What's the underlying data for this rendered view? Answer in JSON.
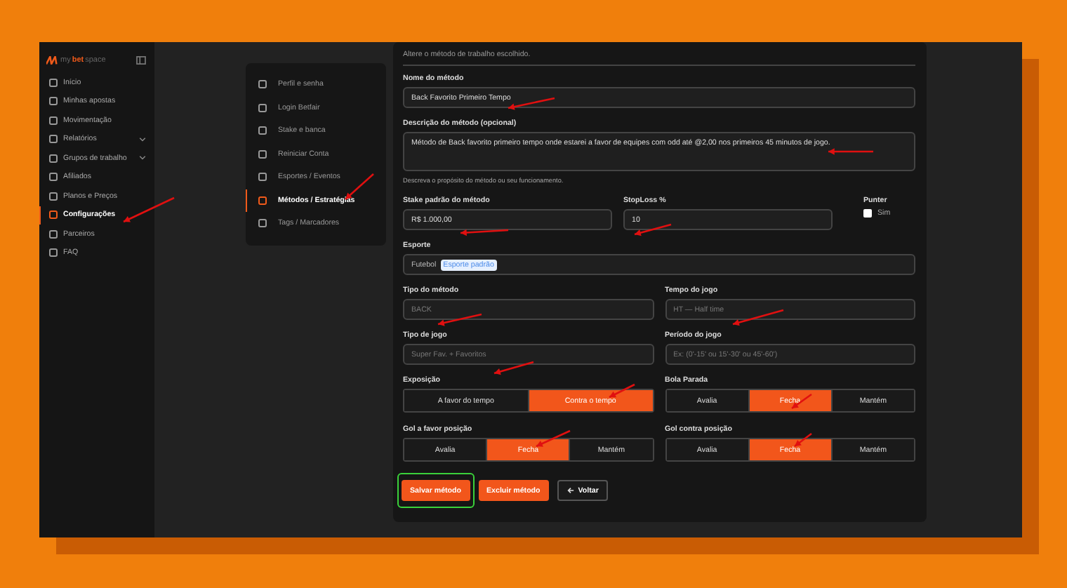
{
  "logo": {
    "prefix": "my",
    "brand": "bet",
    "suffix": "space"
  },
  "sidebar": {
    "items": [
      {
        "label": "Início",
        "selected": false,
        "expandable": false
      },
      {
        "label": "Minhas apostas",
        "selected": false,
        "expandable": false
      },
      {
        "label": "Movimentação",
        "selected": false,
        "expandable": false
      },
      {
        "label": "Relatórios",
        "selected": false,
        "expandable": true
      },
      {
        "label": "Grupos de trabalho",
        "selected": false,
        "expandable": true
      },
      {
        "label": "Afiliados",
        "selected": false,
        "expandable": false
      },
      {
        "label": "Planos e Preços",
        "selected": false,
        "expandable": false
      },
      {
        "label": "Configurações",
        "selected": true,
        "expandable": false
      },
      {
        "label": "Parceiros",
        "selected": false,
        "expandable": false
      },
      {
        "label": "FAQ",
        "selected": false,
        "expandable": false
      }
    ]
  },
  "settings_menu": {
    "items": [
      {
        "label": "Perfil e senha",
        "selected": false
      },
      {
        "label": "Login Betfair",
        "selected": false
      },
      {
        "label": "Stake e banca",
        "selected": false
      },
      {
        "label": "Reiniciar Conta",
        "selected": false
      },
      {
        "label": "Esportes / Eventos",
        "selected": false
      },
      {
        "label": "Métodos / Estratégias",
        "selected": true
      },
      {
        "label": "Tags / Marcadores",
        "selected": false
      }
    ]
  },
  "form": {
    "subtitle": "Altere o método de trabalho escolhido.",
    "name": {
      "label": "Nome do método",
      "value": "Back Favorito Primeiro Tempo"
    },
    "description": {
      "label": "Descrição do método (opcional)",
      "value": "Método de Back favorito primeiro tempo onde estarei a favor de equipes com odd até @2,00 nos primeiros 45 minutos de jogo.",
      "hint": "Descreva o propósito do método ou seu funcionamento."
    },
    "stake": {
      "label": "Stake padrão do método",
      "value": "R$ 1.000,00"
    },
    "stoploss": {
      "label": "StopLoss %",
      "value": "10"
    },
    "punter": {
      "label": "Punter",
      "option": "Sim",
      "checked": false
    },
    "sport": {
      "label": "Esporte",
      "value": "Futebol",
      "tag": "Esporte padrão"
    },
    "selects": [
      {
        "label": "Tipo do método",
        "placeholder": "BACK"
      },
      {
        "label": "Tempo do jogo",
        "placeholder": "HT — Half time"
      },
      {
        "label": "Tipo de jogo",
        "placeholder": "Super Fav. + Favoritos"
      },
      {
        "label": "Período do jogo",
        "placeholder": "Ex: (0'-15' ou 15'-30' ou 45'-60')"
      }
    ],
    "segments": [
      {
        "label": "Exposição",
        "options": [
          {
            "label": "A favor do tempo",
            "selected": false
          },
          {
            "label": "Contra o tempo",
            "selected": true
          }
        ]
      },
      {
        "label": "Bola Parada",
        "options": [
          {
            "label": "Avalia",
            "selected": false
          },
          {
            "label": "Fecha",
            "selected": true
          },
          {
            "label": "Mantém",
            "selected": false
          }
        ]
      },
      {
        "label": "Gol a favor posição",
        "options": [
          {
            "label": "Avalia",
            "selected": false
          },
          {
            "label": "Fecha",
            "selected": true
          },
          {
            "label": "Mantém",
            "selected": false
          }
        ]
      },
      {
        "label": "Gol contra posição",
        "options": [
          {
            "label": "Avalia",
            "selected": false
          },
          {
            "label": "Fecha",
            "selected": true
          },
          {
            "label": "Mantém",
            "selected": false
          }
        ]
      }
    ],
    "buttons": [
      {
        "label": "Salvar método",
        "kind": "primary",
        "highlighted": true
      },
      {
        "label": "Excluir método",
        "kind": "danger",
        "highlighted": false
      },
      {
        "label": "Voltar",
        "kind": "back",
        "highlighted": false
      }
    ]
  }
}
